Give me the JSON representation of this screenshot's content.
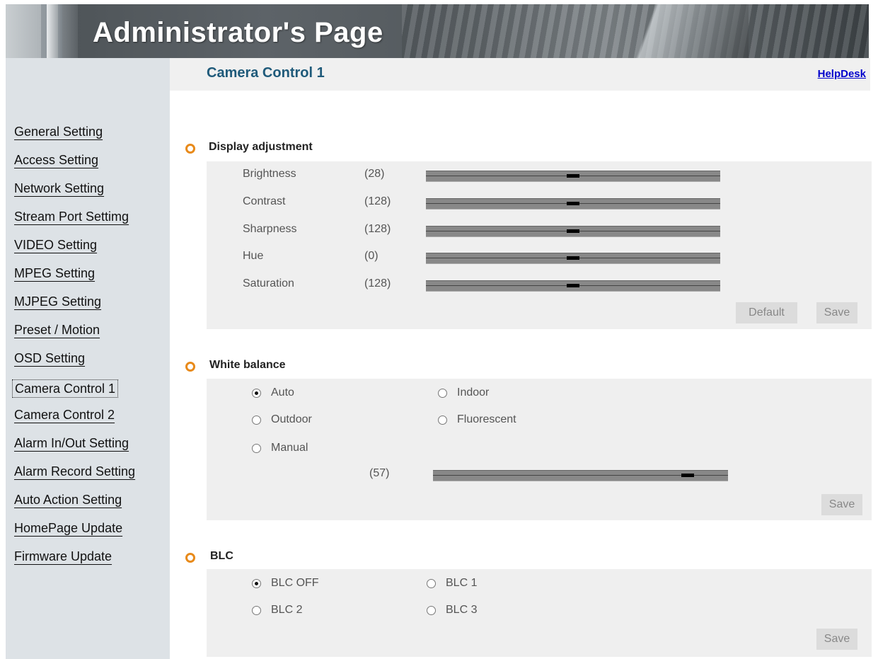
{
  "header": {
    "title": "Administrator's Page"
  },
  "sidebar": {
    "items": [
      {
        "label": "General Setting"
      },
      {
        "label": "Access Setting"
      },
      {
        "label": "Network Setting"
      },
      {
        "label": "Stream Port Settimg"
      },
      {
        "label": "VIDEO Setting"
      },
      {
        "label": "MPEG Setting"
      },
      {
        "label": "MJPEG Setting"
      },
      {
        "label": "Preset / Motion"
      },
      {
        "label": "OSD Setting"
      },
      {
        "label": "Camera Control 1"
      },
      {
        "label": "Camera Control 2"
      },
      {
        "label": "Alarm In/Out Setting"
      },
      {
        "label": "Alarm Record Setting"
      },
      {
        "label": "Auto Action Setting"
      },
      {
        "label": "HomePage Update"
      },
      {
        "label": "Firmware Update"
      }
    ],
    "active_index": 9
  },
  "main": {
    "title": "Camera Control 1",
    "helpdesk": "HelpDesk"
  },
  "display": {
    "title": "Display adjustment",
    "rows": [
      {
        "label": "Brightness",
        "value": "(28)",
        "position": 0.5
      },
      {
        "label": "Contrast",
        "value": "(128)",
        "position": 0.5
      },
      {
        "label": "Sharpness",
        "value": "(128)",
        "position": 0.5
      },
      {
        "label": "Hue",
        "value": "(0)",
        "position": 0.5
      },
      {
        "label": "Saturation",
        "value": "(128)",
        "position": 0.5
      }
    ],
    "default_label": "Default",
    "save_label": "Save"
  },
  "white_balance": {
    "title": "White balance",
    "options": [
      {
        "label": "Auto",
        "checked": true
      },
      {
        "label": "Indoor",
        "checked": false
      },
      {
        "label": "Outdoor",
        "checked": false
      },
      {
        "label": "Fluorescent",
        "checked": false
      },
      {
        "label": "Manual",
        "checked": false
      }
    ],
    "manual_value": "(57)",
    "manual_position": 0.88,
    "save_label": "Save"
  },
  "blc": {
    "title": "BLC",
    "options": [
      {
        "label": "BLC OFF",
        "checked": true
      },
      {
        "label": "BLC 1",
        "checked": false
      },
      {
        "label": "BLC 2",
        "checked": false
      },
      {
        "label": "BLC 3",
        "checked": false
      }
    ],
    "save_label": "Save"
  },
  "colors": {
    "accent": "#e88a1a",
    "title": "#1f5a7a",
    "link": "#0000cc",
    "sidebar": "#dde2e6",
    "panel": "#efefef"
  }
}
